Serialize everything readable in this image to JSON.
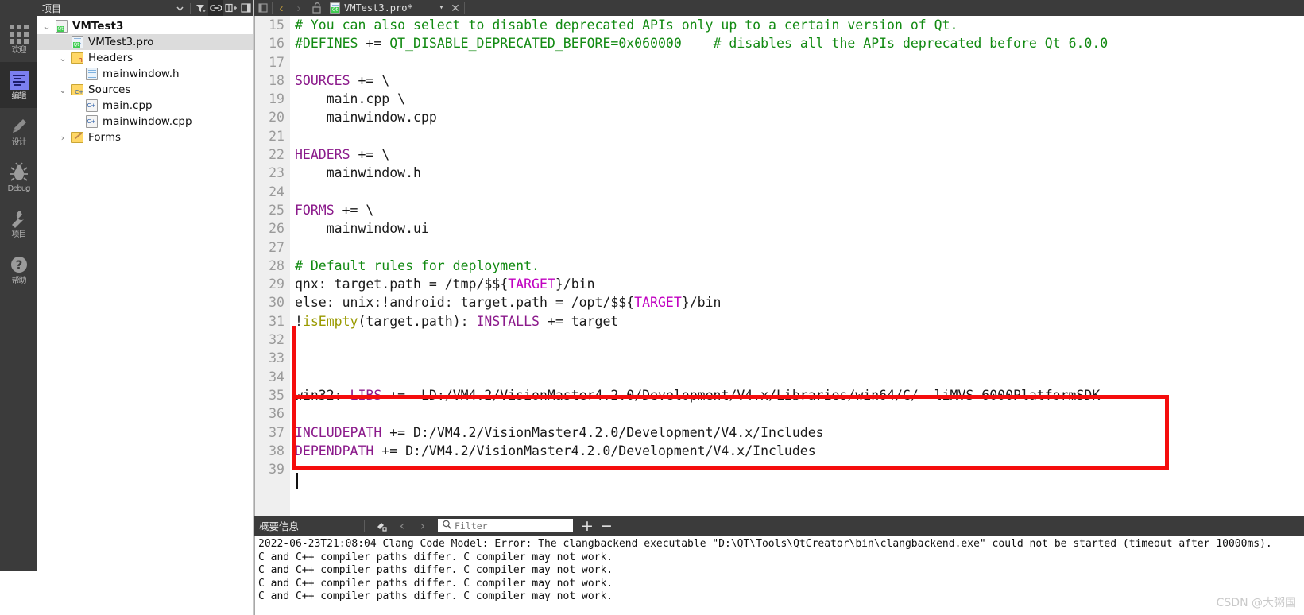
{
  "modebar": {
    "items": [
      {
        "label": "欢迎",
        "icon": "grid-icon",
        "active": false
      },
      {
        "label": "编辑",
        "icon": "edit-icon",
        "active": true
      },
      {
        "label": "设计",
        "icon": "pencil-icon",
        "active": false
      },
      {
        "label": "Debug",
        "icon": "bug-icon",
        "active": false
      },
      {
        "label": "项目",
        "icon": "wrench-icon",
        "active": false
      },
      {
        "label": "帮助",
        "icon": "question-icon",
        "active": false
      }
    ]
  },
  "sidebar": {
    "title": "项目",
    "buttons": [
      {
        "name": "dropdown-caret",
        "glyph": "▾"
      },
      {
        "name": "filter-icon",
        "glyph": "▼"
      },
      {
        "name": "link-icon",
        "glyph": "⛓"
      },
      {
        "name": "split-icon",
        "glyph": "▤+"
      },
      {
        "name": "collapse-icon",
        "glyph": "◧"
      }
    ],
    "tree": [
      {
        "label": "VMTest3",
        "indent": 0,
        "arrow": "⌄",
        "icon": "qt-project-icon",
        "bold": true,
        "selected": false
      },
      {
        "label": "VMTest3.pro",
        "indent": 1,
        "arrow": "",
        "icon": "pro-file-icon",
        "bold": false,
        "selected": true
      },
      {
        "label": "Headers",
        "indent": 1,
        "arrow": "⌄",
        "icon": "folder-h-icon",
        "bold": false,
        "selected": false
      },
      {
        "label": "mainwindow.h",
        "indent": 2,
        "arrow": "",
        "icon": "header-file-icon",
        "bold": false,
        "selected": false
      },
      {
        "label": "Sources",
        "indent": 1,
        "arrow": "⌄",
        "icon": "folder-cpp-icon",
        "bold": false,
        "selected": false
      },
      {
        "label": "main.cpp",
        "indent": 2,
        "arrow": "",
        "icon": "cpp-file-icon",
        "bold": false,
        "selected": false
      },
      {
        "label": "mainwindow.cpp",
        "indent": 2,
        "arrow": "",
        "icon": "cpp-file-icon",
        "bold": false,
        "selected": false
      },
      {
        "label": "Forms",
        "indent": 1,
        "arrow": "›",
        "icon": "folder-form-icon",
        "bold": false,
        "selected": false
      }
    ]
  },
  "tabbar": {
    "nav_back": "‹",
    "nav_forward": "›",
    "lock_icon": "🔓",
    "tab_title": "VMTest3.pro*",
    "tab_caret": "▾",
    "tab_close": "✕",
    "left_collapse": "◧"
  },
  "editor": {
    "first_line_number": 15,
    "lines": [
      {
        "n": 15,
        "tokens": [
          {
            "t": "# You can also select to disable deprecated APIs only up to a certain version of Qt.",
            "c": "c-comment"
          }
        ]
      },
      {
        "n": 16,
        "tokens": [
          {
            "t": "#DEFINES",
            "c": "c-comment"
          },
          {
            "t": " += ",
            "c": "c-plain"
          },
          {
            "t": "QT_DISABLE_DEPRECATED_BEFORE=0x060000",
            "c": "c-comment"
          },
          {
            "t": "    ",
            "c": "c-plain"
          },
          {
            "t": "# disables all the APIs deprecated before Qt 6.0.0",
            "c": "c-comment"
          }
        ]
      },
      {
        "n": 17,
        "tokens": []
      },
      {
        "n": 18,
        "tokens": [
          {
            "t": "SOURCES",
            "c": "c-kw"
          },
          {
            "t": " += \\",
            "c": "c-plain"
          }
        ]
      },
      {
        "n": 19,
        "tokens": [
          {
            "t": "    main.cpp \\",
            "c": "c-plain"
          }
        ]
      },
      {
        "n": 20,
        "tokens": [
          {
            "t": "    mainwindow.cpp",
            "c": "c-plain"
          }
        ]
      },
      {
        "n": 21,
        "tokens": []
      },
      {
        "n": 22,
        "tokens": [
          {
            "t": "HEADERS",
            "c": "c-kw"
          },
          {
            "t": " += \\",
            "c": "c-plain"
          }
        ]
      },
      {
        "n": 23,
        "tokens": [
          {
            "t": "    mainwindow.h",
            "c": "c-plain"
          }
        ]
      },
      {
        "n": 24,
        "tokens": []
      },
      {
        "n": 25,
        "tokens": [
          {
            "t": "FORMS",
            "c": "c-kw"
          },
          {
            "t": " += \\",
            "c": "c-plain"
          }
        ]
      },
      {
        "n": 26,
        "tokens": [
          {
            "t": "    mainwindow.ui",
            "c": "c-plain"
          }
        ]
      },
      {
        "n": 27,
        "tokens": []
      },
      {
        "n": 28,
        "tokens": [
          {
            "t": "# Default rules for deployment.",
            "c": "c-comment"
          }
        ]
      },
      {
        "n": 29,
        "tokens": [
          {
            "t": "qnx: target.path = /tmp/$$",
            "c": "c-plain"
          },
          {
            "t": "{",
            "c": "c-plain"
          },
          {
            "t": "TARGET",
            "c": "c-var"
          },
          {
            "t": "}/bin",
            "c": "c-plain"
          }
        ]
      },
      {
        "n": 30,
        "tokens": [
          {
            "t": "else: unix:!android: target.path = /opt/$$",
            "c": "c-plain"
          },
          {
            "t": "{",
            "c": "c-plain"
          },
          {
            "t": "TARGET",
            "c": "c-var"
          },
          {
            "t": "}/bin",
            "c": "c-plain"
          }
        ]
      },
      {
        "n": 31,
        "tokens": [
          {
            "t": "!",
            "c": "c-plain"
          },
          {
            "t": "isEmpty",
            "c": "c-func"
          },
          {
            "t": "(target.path): ",
            "c": "c-plain"
          },
          {
            "t": "INSTALLS",
            "c": "c-kw"
          },
          {
            "t": " += target",
            "c": "c-plain"
          }
        ]
      },
      {
        "n": 32,
        "tokens": []
      },
      {
        "n": 33,
        "tokens": []
      },
      {
        "n": 34,
        "tokens": []
      },
      {
        "n": 35,
        "tokens": [
          {
            "t": "win32: ",
            "c": "c-plain"
          },
          {
            "t": "LIBS",
            "c": "c-kw"
          },
          {
            "t": " += -LD:/VM4.2/VisionMaster4.2.0/Development/V4.x/Libraries/win64/C/ -liMVS-6000PlatformSDK",
            "c": "c-plain"
          }
        ]
      },
      {
        "n": 36,
        "tokens": []
      },
      {
        "n": 37,
        "tokens": [
          {
            "t": "INCLUDEPATH",
            "c": "c-kw"
          },
          {
            "t": " += D:/VM4.2/VisionMaster4.2.0/Development/V4.x/Includes",
            "c": "c-plain"
          }
        ]
      },
      {
        "n": 38,
        "tokens": [
          {
            "t": "DEPENDPATH",
            "c": "c-kw"
          },
          {
            "t": " += D:/VM4.2/VisionMaster4.2.0/Development/V4.x/Includes",
            "c": "c-plain"
          }
        ]
      },
      {
        "n": 39,
        "tokens": []
      }
    ],
    "annotation_color": "#f50d0d"
  },
  "panel": {
    "title": "概要信息",
    "clean_icon": "⎚",
    "prev_icon": "‹",
    "next_icon": "›",
    "search_icon": "⌕",
    "filter_placeholder": "Filter",
    "filter_value": "",
    "plus_label": "+",
    "minus_label": "−",
    "console_lines": [
      "2022-06-23T21:08:04 Clang Code Model: Error: The clangbackend executable \"D:\\QT\\Tools\\QtCreator\\bin\\clangbackend.exe\" could not be started (timeout after 10000ms).",
      "C and C++ compiler paths differ. C compiler may not work.",
      "C and C++ compiler paths differ. C compiler may not work.",
      "C and C++ compiler paths differ. C compiler may not work.",
      "C and C++ compiler paths differ. C compiler may not work."
    ]
  },
  "watermark": "CSDN @大粥国"
}
